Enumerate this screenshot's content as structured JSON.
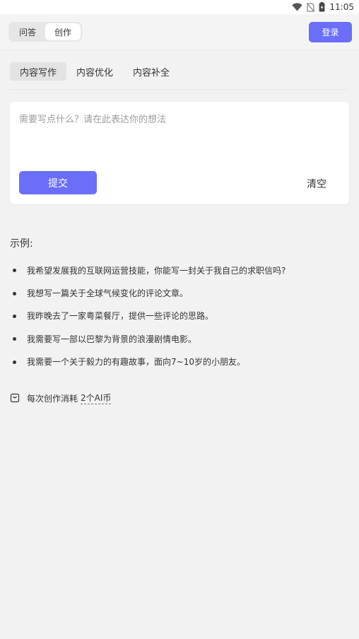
{
  "status_bar": {
    "time": "11:05",
    "icons": [
      "wifi-icon",
      "no-sim-icon",
      "battery-icon"
    ]
  },
  "header": {
    "segments": [
      {
        "label": "问答",
        "active": false
      },
      {
        "label": "创作",
        "active": true
      }
    ],
    "login_label": "登录"
  },
  "sub_tabs": [
    {
      "label": "内容写作",
      "active": true
    },
    {
      "label": "内容优化",
      "active": false
    },
    {
      "label": "内容补全",
      "active": false
    }
  ],
  "editor": {
    "placeholder": "需要写点什么？请在此表达你的想法",
    "submit_label": "提交",
    "clear_label": "清空"
  },
  "examples": {
    "title": "示例:",
    "items": [
      "我希望发展我的互联网运营技能，你能写一封关于我自己的求职信吗?",
      "我想写一篇关于全球气候变化的评论文章。",
      "我昨晚去了一家粤菜餐厅，提供一些评论的思路。",
      "我需要写一部以巴黎为背景的浪漫剧情电影。",
      "我需要一个关于毅力的有趣故事，面向7~10岁的小朋友。"
    ]
  },
  "cost_note": {
    "prefix": "每次创作消耗",
    "amount": "2个AI币",
    "icon": "bag-icon"
  },
  "colors": {
    "accent": "#6b6ef9",
    "background": "#f2f2f2"
  }
}
